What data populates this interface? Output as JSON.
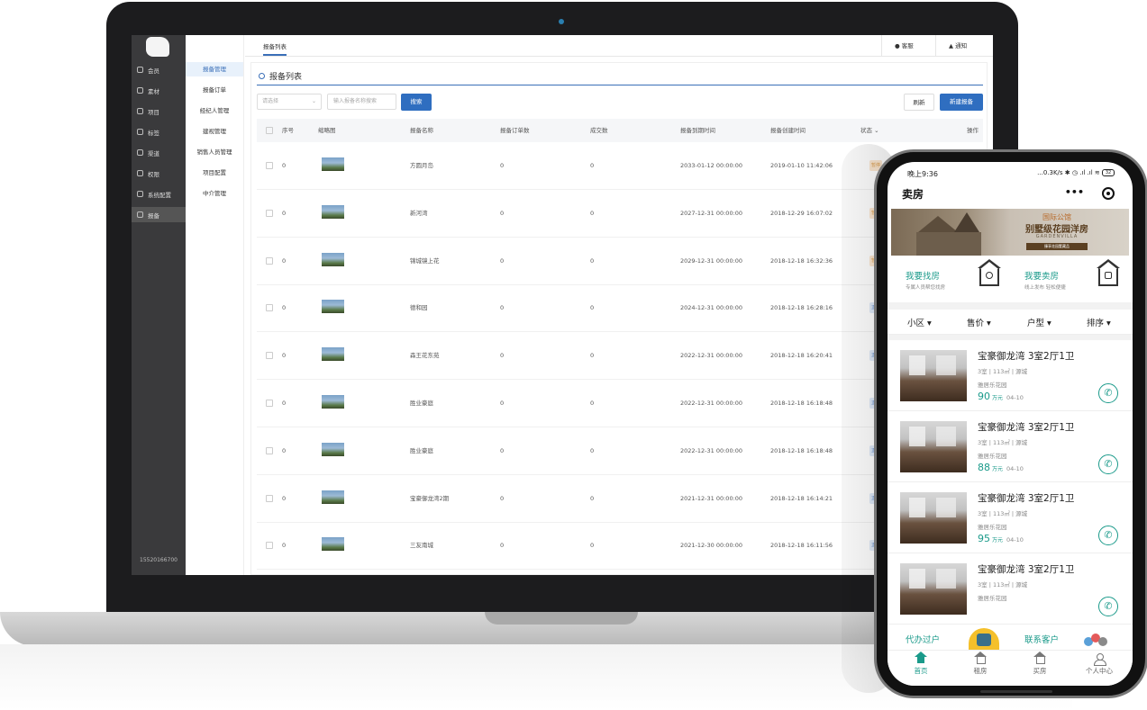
{
  "admin": {
    "sidebar_primary": [
      {
        "label": "会员",
        "icon": "member-icon"
      },
      {
        "label": "素材",
        "icon": "material-icon"
      },
      {
        "label": "项目",
        "icon": "project-icon"
      },
      {
        "label": "标签",
        "icon": "tag-icon"
      },
      {
        "label": "渠道",
        "icon": "channel-icon"
      },
      {
        "label": "权限",
        "icon": "permission-icon"
      },
      {
        "label": "系统配置",
        "icon": "settings-icon"
      },
      {
        "label": "报备",
        "icon": "report-icon",
        "active": true
      }
    ],
    "footer_phone": "15520166700",
    "sidebar_secondary": [
      {
        "label": "报备管理",
        "active": true
      },
      {
        "label": "报备订单"
      },
      {
        "label": "经纪人管理"
      },
      {
        "label": "建视管理"
      },
      {
        "label": "销售人员管理"
      },
      {
        "label": "项目配置"
      },
      {
        "label": "中介管理"
      }
    ],
    "tab_label": "报备列表",
    "top_actions": {
      "service": "客服",
      "notify": "通知"
    },
    "panel_title": "报备列表",
    "filter": {
      "select_placeholder": "请选择",
      "search_placeholder": "输入报备名称搜索",
      "search_button": "搜索"
    },
    "actions": {
      "refresh": "刷新",
      "create": "新建报备"
    },
    "columns": [
      "序号",
      "缩略图",
      "报备名称",
      "报备订单数",
      "成交数",
      "报备到期时间",
      "报备创建时间",
      "状态",
      "操作"
    ],
    "rows": [
      {
        "index": "0",
        "name": "方圆月岛",
        "orders": "0",
        "deals": "0",
        "expire": "2033-01-12 00:00:00",
        "created": "2019-01-10 11:42:06",
        "status": "暂停",
        "status_type": "paused"
      },
      {
        "index": "0",
        "name": "新河湾",
        "orders": "0",
        "deals": "0",
        "expire": "2027-12-31 00:00:00",
        "created": "2018-12-29 16:07:02",
        "status": "暂停",
        "status_type": "paused"
      },
      {
        "index": "0",
        "name": "锦城镜上花",
        "orders": "0",
        "deals": "0",
        "expire": "2029-12-31 00:00:00",
        "created": "2018-12-18 16:32:36",
        "status": "暂停",
        "status_type": "paused"
      },
      {
        "index": "0",
        "name": "德和园",
        "orders": "0",
        "deals": "0",
        "expire": "2024-12-31 00:00:00",
        "created": "2018-12-18 16:28:16",
        "status": "正常",
        "status_type": "ok"
      },
      {
        "index": "0",
        "name": "森王花东苑",
        "orders": "0",
        "deals": "0",
        "expire": "2022-12-31 00:00:00",
        "created": "2018-12-18 16:20:41",
        "status": "正常",
        "status_type": "ok"
      },
      {
        "index": "0",
        "name": "胜业豪庭",
        "orders": "0",
        "deals": "0",
        "expire": "2022-12-31 00:00:00",
        "created": "2018-12-18 16:18:48",
        "status": "正常",
        "status_type": "ok"
      },
      {
        "index": "0",
        "name": "胜业豪庭",
        "orders": "0",
        "deals": "0",
        "expire": "2022-12-31 00:00:00",
        "created": "2018-12-18 16:18:48",
        "status": "正常",
        "status_type": "ok"
      },
      {
        "index": "0",
        "name": "宝豪御龙湾2期",
        "orders": "0",
        "deals": "0",
        "expire": "2021-12-31 00:00:00",
        "created": "2018-12-18 16:14:21",
        "status": "正常",
        "status_type": "ok"
      },
      {
        "index": "0",
        "name": "三友南城",
        "orders": "0",
        "deals": "0",
        "expire": "2021-12-30 00:00:00",
        "created": "2018-12-18 16:11:56",
        "status": "正常",
        "status_type": "ok"
      }
    ]
  },
  "phone": {
    "status_time": "晚上9:36",
    "status_right": "...0.3K/s ✱ ◷ .ıl .ıl ≋",
    "battery": "32",
    "title": "卖房",
    "more": "•••",
    "banner": {
      "line1": "国际公馆",
      "line2": "别墅级花园洋房",
      "line3": "GARDENVILLA",
      "line4": "臻享花园墅藏品"
    },
    "quick": [
      {
        "title": "我要找房",
        "sub": "专属人员帮您找房"
      },
      {
        "title": "我要卖房",
        "sub": "线上发布 轻松便捷"
      }
    ],
    "filters": [
      "小区 ▾",
      "售价 ▾",
      "户型 ▾",
      "排序 ▾"
    ],
    "listings": [
      {
        "title": "宝豪御龙湾  3室2厅1卫",
        "spec": "3室 | 113㎡ | 源城",
        "community": "雅居乐花园",
        "price": "90",
        "unit": "万元",
        "date": "04-10"
      },
      {
        "title": "宝豪御龙湾  3室2厅1卫",
        "spec": "3室 | 113㎡ | 源城",
        "community": "雅居乐花园",
        "price": "88",
        "unit": "万元",
        "date": "04-10"
      },
      {
        "title": "宝豪御龙湾  3室2厅1卫",
        "spec": "3室 | 113㎡ | 源城",
        "community": "雅居乐花园",
        "price": "95",
        "unit": "万元",
        "date": "04-10"
      },
      {
        "title": "宝豪御龙湾  3室2厅1卫",
        "spec": "3室 | 113㎡ | 源城",
        "community": "雅居乐花园",
        "price": "",
        "unit": "",
        "date": ""
      }
    ],
    "bottom_quick": {
      "left": "代办过户",
      "right": "联系客户"
    },
    "tabs": [
      {
        "label": "首页",
        "icon": "home-icon",
        "active": true
      },
      {
        "label": "租房",
        "icon": "rent-icon"
      },
      {
        "label": "买房",
        "icon": "buy-icon"
      },
      {
        "label": "个人中心",
        "icon": "user-icon"
      }
    ],
    "accent": "#1a9a8a"
  }
}
